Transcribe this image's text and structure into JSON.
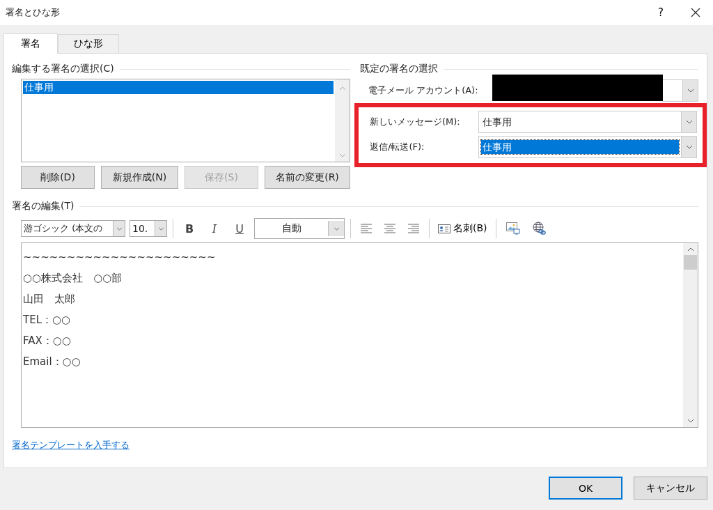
{
  "window": {
    "title": "署名とひな形",
    "help": "?"
  },
  "tabs": [
    {
      "label": "署名",
      "selected": true
    },
    {
      "label": "ひな形",
      "selected": false
    }
  ],
  "signature_list": {
    "heading": "編集する署名の選択(C)",
    "items": [
      {
        "label": "仕事用",
        "selected": true
      }
    ]
  },
  "signature_buttons": [
    {
      "label": "削除(D)",
      "disabled": false
    },
    {
      "label": "新規作成(N)",
      "disabled": false
    },
    {
      "label": "保存(S)",
      "disabled": true
    },
    {
      "label": "名前の変更(R)",
      "disabled": false
    }
  ],
  "default_signature": {
    "heading": "既定の署名の選択",
    "account": {
      "label": "電子メール アカウント(A):",
      "redacted": true
    },
    "annotation_frame": true,
    "fields": [
      {
        "label": "新しいメッセージ(M):",
        "value": "仕事用",
        "selected": false
      },
      {
        "label": "返信/転送(F):",
        "value": "仕事用",
        "selected": true
      }
    ]
  },
  "editor": {
    "heading": "署名の編集(T)",
    "font": "游ゴシック (本文の",
    "size": "10.",
    "bold": "B",
    "italic": "I",
    "underline": "U",
    "font_color_label": "自動",
    "card_button": "名刺(B)",
    "lines": [
      "~~~~~~~~~~~~~~~~~~~~~~",
      "○○株式会社　○○部",
      "山田　太郎",
      "TEL：○○",
      "FAX：○○",
      "Email：○○"
    ]
  },
  "template_link": "署名テンプレートを入手する",
  "buttons": [
    {
      "label": "OK",
      "default": true
    },
    {
      "label": "キャンセル",
      "default": false
    }
  ]
}
